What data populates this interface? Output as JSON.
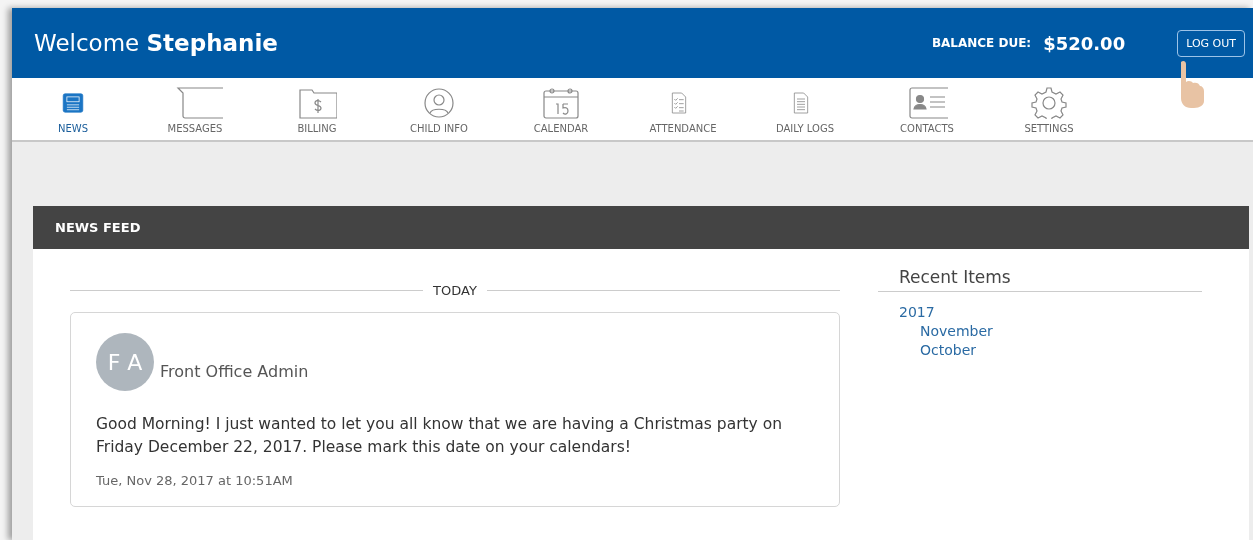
{
  "header": {
    "greeting": "Welcome",
    "name": "Stephanie",
    "balance_label": "BALANCE DUE:",
    "balance": "$520.00",
    "logout": "LOG OUT"
  },
  "nav": [
    {
      "label": "NEWS",
      "kind": "news",
      "selected": true
    },
    {
      "label": "MESSAGES",
      "kind": "messages",
      "selected": false
    },
    {
      "label": "BILLING",
      "kind": "billing",
      "selected": false
    },
    {
      "label": "CHILD INFO",
      "kind": "child",
      "selected": false
    },
    {
      "label": "CALENDAR",
      "kind": "calendar",
      "selected": false
    },
    {
      "label": "ATTENDANCE",
      "kind": "attendance",
      "selected": false
    },
    {
      "label": "DAILY LOGS",
      "kind": "logs",
      "selected": false
    },
    {
      "label": "CONTACTS",
      "kind": "contacts",
      "selected": false
    },
    {
      "label": "SETTINGS",
      "kind": "settings",
      "selected": false
    }
  ],
  "news_feed": {
    "title": "NEWS FEED",
    "divider": "TODAY",
    "posts": [
      {
        "initials": "F A",
        "author": "Front Office Admin",
        "body": "Good Morning! I just wanted to let you all know that we are having a Christmas party on Friday December 22, 2017. Please mark this date on your calendars!",
        "time": "Tue, Nov 28, 2017 at 10:51AM"
      }
    ]
  },
  "recent_items": {
    "title": "Recent Items",
    "years": [
      {
        "label": "2017",
        "children": [
          {
            "label": "November"
          },
          {
            "label": "October"
          }
        ]
      }
    ]
  }
}
